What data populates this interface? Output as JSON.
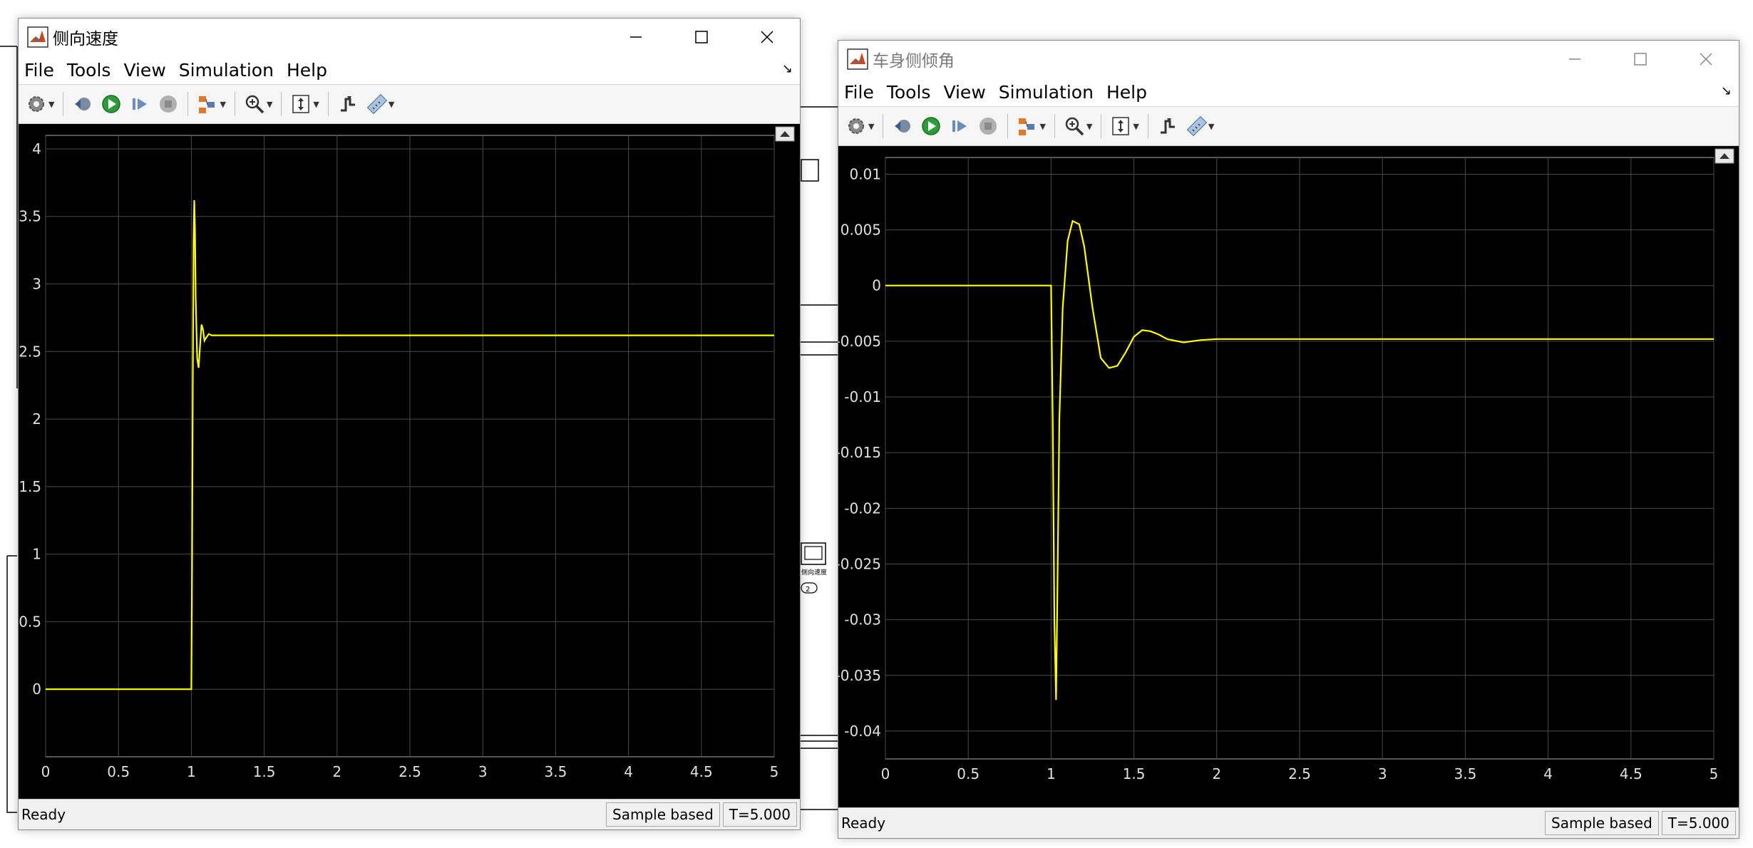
{
  "windows": [
    {
      "title": "侧向速度",
      "title_active": true,
      "menu": [
        "File",
        "Tools",
        "View",
        "Simulation",
        "Help"
      ],
      "status": {
        "ready": "Ready",
        "sample": "Sample based",
        "time": "T=5.000"
      }
    },
    {
      "title": "车身侧倾角",
      "title_active": false,
      "menu": [
        "File",
        "Tools",
        "View",
        "Simulation",
        "Help"
      ],
      "status": {
        "ready": "Ready",
        "sample": "Sample based",
        "time": "T=5.000"
      }
    }
  ],
  "background_labels": {
    "block_caption": "侧向速度",
    "port_number": "2"
  },
  "chart_data": [
    {
      "type": "line",
      "title": "",
      "xlabel": "",
      "ylabel": "",
      "xlim": [
        0,
        5
      ],
      "ylim": [
        -0.5,
        4.1
      ],
      "grid": true,
      "line_color": "#ffff00",
      "x_ticks": [
        "0",
        "0.5",
        "1",
        "1.5",
        "2",
        "2.5",
        "3",
        "3.5",
        "4",
        "4.5",
        "5"
      ],
      "y_ticks": [
        "0",
        "0.5",
        "1",
        "1.5",
        "2",
        "2.5",
        "3",
        "3.5",
        "4"
      ],
      "series": [
        {
          "x": [
            0,
            1.0,
            1.005,
            1.01,
            1.015,
            1.02,
            1.025,
            1.03,
            1.04,
            1.05,
            1.06,
            1.07,
            1.08,
            1.09,
            1.1,
            1.12,
            1.14,
            1.16,
            1.2,
            1.3,
            2.0,
            3.0,
            4.0,
            5.0
          ],
          "y": [
            0,
            0,
            0.9,
            2.2,
            3.3,
            3.62,
            3.4,
            2.9,
            2.45,
            2.38,
            2.55,
            2.7,
            2.66,
            2.58,
            2.6,
            2.63,
            2.62,
            2.62,
            2.62,
            2.62,
            2.62,
            2.62,
            2.62,
            2.62
          ]
        }
      ]
    },
    {
      "type": "line",
      "title": "",
      "xlabel": "",
      "ylabel": "",
      "xlim": [
        0,
        5
      ],
      "ylim": [
        -0.0425,
        0.0115
      ],
      "grid": true,
      "line_color": "#ffff00",
      "x_ticks": [
        "0",
        "0.5",
        "1",
        "1.5",
        "2",
        "2.5",
        "3",
        "3.5",
        "4",
        "4.5",
        "5"
      ],
      "y_ticks": [
        "0.01",
        "0.005",
        "0",
        "-0.005",
        "-0.01",
        "-0.015",
        "-0.02",
        "-0.025",
        "-0.03",
        "-0.035",
        "-0.04"
      ],
      "series": [
        {
          "x": [
            0,
            1.0,
            1.01,
            1.02,
            1.03,
            1.04,
            1.05,
            1.07,
            1.1,
            1.13,
            1.17,
            1.2,
            1.25,
            1.3,
            1.35,
            1.4,
            1.45,
            1.5,
            1.55,
            1.6,
            1.65,
            1.7,
            1.8,
            1.9,
            2.0,
            2.5,
            3.0,
            4.0,
            5.0
          ],
          "y": [
            0,
            0,
            -0.012,
            -0.03,
            -0.0372,
            -0.025,
            -0.012,
            -0.002,
            0.004,
            0.0058,
            0.0055,
            0.0035,
            -0.002,
            -0.0065,
            -0.0074,
            -0.0072,
            -0.006,
            -0.0046,
            -0.004,
            -0.0041,
            -0.0044,
            -0.0048,
            -0.0051,
            -0.0049,
            -0.0048,
            -0.0048,
            -0.0048,
            -0.0048,
            -0.0048
          ]
        }
      ]
    }
  ]
}
